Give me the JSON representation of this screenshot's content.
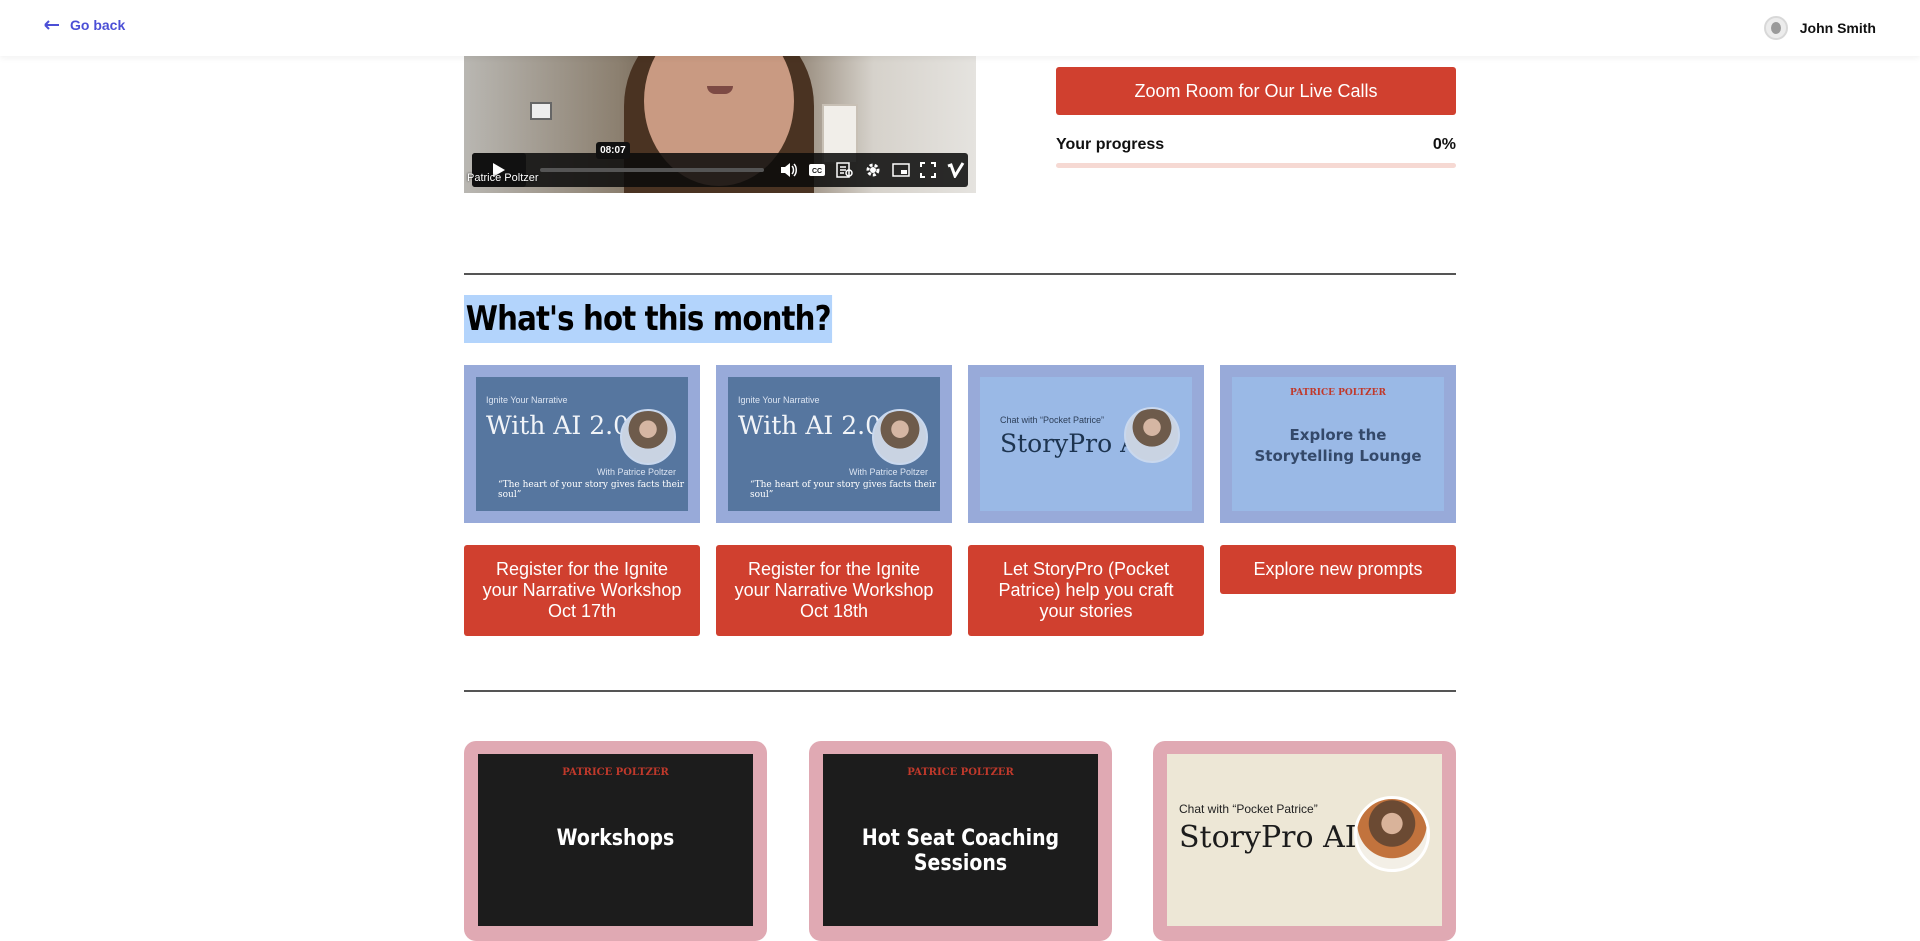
{
  "header": {
    "back_label": "Go back",
    "user_name": "John Smith"
  },
  "video": {
    "time_tooltip": "08:07",
    "caption": "Patrice Poltzer"
  },
  "sidebar": {
    "zoom_button": "Zoom Room for Our Live Calls",
    "progress_label": "Your progress",
    "progress_value": "0%",
    "progress_fraction": 0
  },
  "hot": {
    "title": "What's hot this month?",
    "cards": [
      {
        "small": "Ignite Your Narrative",
        "big": "With AI 2.0",
        "byline": "With Patrice Poltzer",
        "quote": "“The heart of your story gives facts their soul”",
        "button": "Register for the Ignite your Narrative Workshop Oct 17th"
      },
      {
        "small": "Ignite Your Narrative",
        "big": "With AI 2.0",
        "byline": "With Patrice Poltzer",
        "quote": "“The heart of your story gives facts their soul”",
        "button": "Register for the Ignite your Narrative Workshop Oct 18th"
      },
      {
        "small": "Chat with “Pocket Patrice”",
        "big": "StoryPro AI",
        "button": "Let StoryPro (Pocket Patrice) help you craft your stories"
      },
      {
        "logo": "PATRICE POLTZER",
        "big": "Explore the Storytelling Lounge",
        "button": "Explore new prompts"
      }
    ]
  },
  "bottom": {
    "cards": [
      {
        "logo": "PATRICE POLTZER",
        "label": "Workshops"
      },
      {
        "logo": "PATRICE POLTZER",
        "label": "Hot Seat Coaching Sessions"
      },
      {
        "small": "Chat with “Pocket Patrice”",
        "label": "StoryPro AI"
      }
    ]
  },
  "colors": {
    "accent": "#d0402f",
    "link": "#4b4fd6",
    "card_frame_blue": "#98aad9",
    "card_frame_pink": "#e0a9b3"
  }
}
